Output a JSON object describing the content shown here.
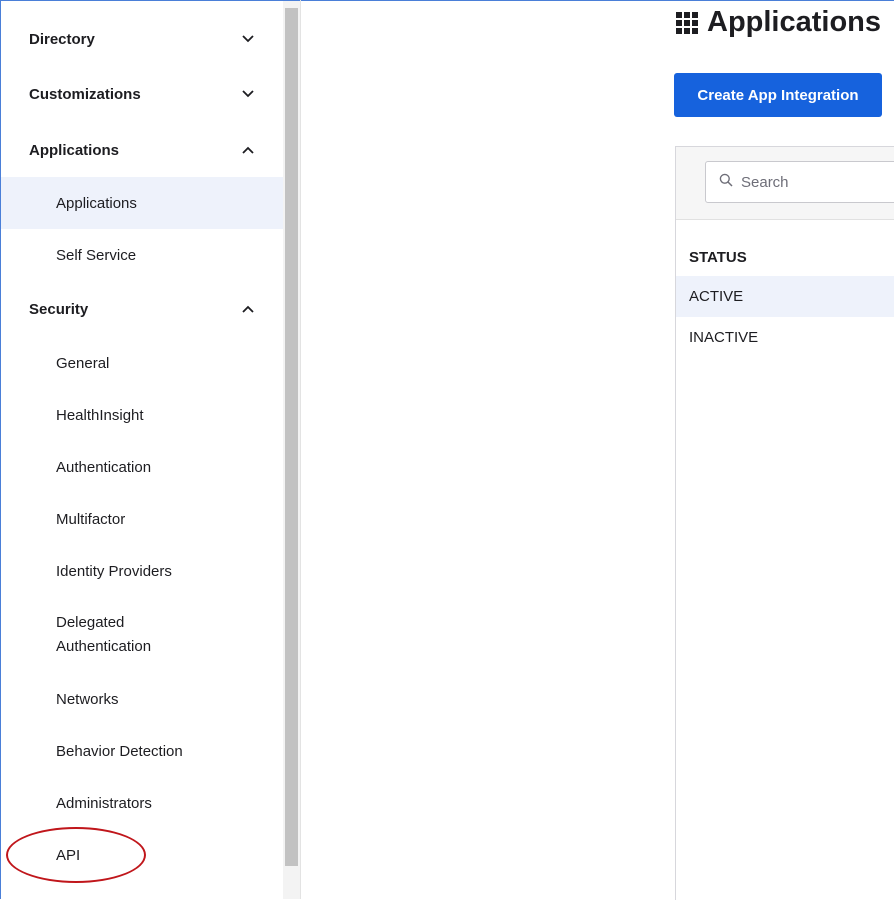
{
  "sidebar": {
    "sections": [
      {
        "label": "Directory",
        "state": "collapsed",
        "chevron_icon": "chevron-down-icon"
      },
      {
        "label": "Customizations",
        "state": "collapsed",
        "chevron_icon": "chevron-down-icon"
      },
      {
        "label": "Applications",
        "state": "expanded",
        "chevron_icon": "chevron-up-icon",
        "items": [
          {
            "label": "Applications",
            "selected": true
          },
          {
            "label": "Self Service",
            "selected": false
          }
        ]
      },
      {
        "label": "Security",
        "state": "expanded",
        "chevron_icon": "chevron-up-icon",
        "items": [
          {
            "label": "General"
          },
          {
            "label": "HealthInsight"
          },
          {
            "label": "Authentication"
          },
          {
            "label": "Multifactor"
          },
          {
            "label": "Identity Providers"
          },
          {
            "label": "Delegated Authentication"
          },
          {
            "label": "Networks"
          },
          {
            "label": "Behavior Detection"
          },
          {
            "label": "Administrators"
          },
          {
            "label": "API",
            "highlighted": true
          }
        ]
      }
    ]
  },
  "main": {
    "title": "Applications",
    "title_icon": "grid-icon",
    "create_button_label": "Create App Integration",
    "search": {
      "placeholder": "Search",
      "value": "",
      "icon": "search-icon"
    },
    "status_filter": {
      "header": "STATUS",
      "options": [
        {
          "label": "ACTIVE",
          "selected": true
        },
        {
          "label": "INACTIVE",
          "selected": false
        }
      ]
    }
  },
  "colors": {
    "primary_button": "#1662dd",
    "selected_row": "#eef2fb",
    "annotation": "#c0161b",
    "panel_header": "#f6f6f6"
  }
}
